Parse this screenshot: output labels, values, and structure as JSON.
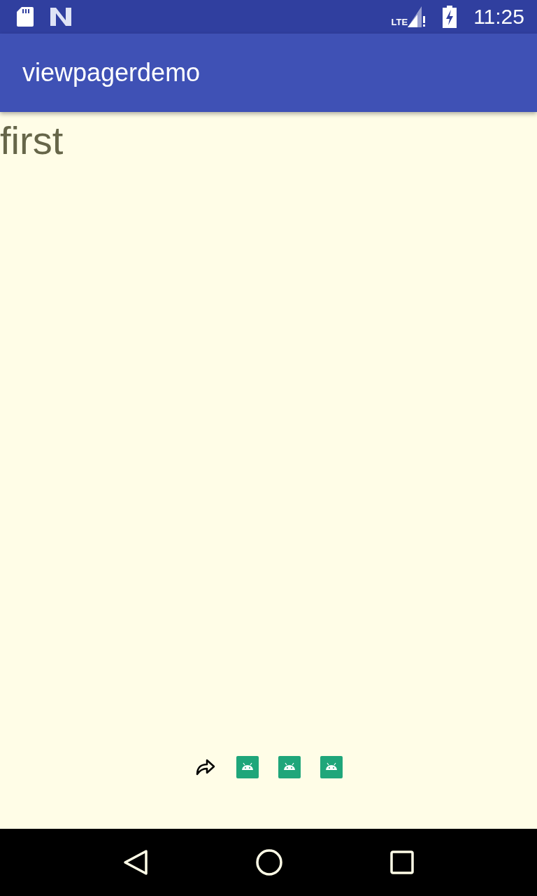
{
  "status_bar": {
    "time": "11:25",
    "network": "LTE"
  },
  "app_bar": {
    "title": "viewpagerdemo"
  },
  "page": {
    "text": "first"
  },
  "indicators": [
    {
      "selected": true
    },
    {
      "selected": false
    },
    {
      "selected": false
    },
    {
      "selected": false
    }
  ]
}
